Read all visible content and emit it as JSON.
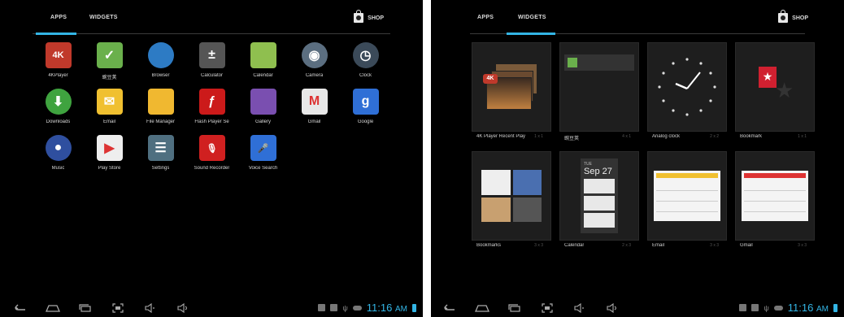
{
  "left": {
    "tabs": {
      "apps": "APPS",
      "widgets": "WIDGETS"
    },
    "shop": "SHOP",
    "apps": [
      {
        "label": "4KPlayer",
        "icon": "4k-player-icon",
        "color": "#c0392b",
        "glyph": "4K"
      },
      {
        "label": "豌豆荚",
        "icon": "wandoujia-icon",
        "color": "#6ab04c",
        "glyph": "✓"
      },
      {
        "label": "Browser",
        "icon": "globe-icon",
        "color": "#2d7bc4",
        "glyph": ""
      },
      {
        "label": "Calculator",
        "icon": "calculator-icon",
        "color": "#555555",
        "glyph": "±"
      },
      {
        "label": "Calendar",
        "icon": "calendar-icon",
        "color": "#8fbf4f",
        "glyph": ""
      },
      {
        "label": "Camera",
        "icon": "camera-icon",
        "color": "#5b6e80",
        "glyph": "◉"
      },
      {
        "label": "Clock",
        "icon": "clock-icon",
        "color": "#3b4a59",
        "glyph": "◷"
      },
      {
        "label": "Downloads",
        "icon": "download-icon",
        "color": "#3fa33f",
        "glyph": "⬇"
      },
      {
        "label": "Email",
        "icon": "email-icon",
        "color": "#f0c030",
        "glyph": "✉"
      },
      {
        "label": "File Manager",
        "icon": "folder-icon",
        "color": "#f0b830",
        "glyph": ""
      },
      {
        "label": "Flash Player Se",
        "icon": "flash-icon",
        "color": "#cc1a1a",
        "glyph": "ƒ"
      },
      {
        "label": "Gallery",
        "icon": "gallery-icon",
        "color": "#7a4fb0",
        "glyph": ""
      },
      {
        "label": "Gmail",
        "icon": "gmail-icon",
        "color": "#e8e8e8",
        "glyph": "M"
      },
      {
        "label": "Google",
        "icon": "google-icon",
        "color": "#2f6fd6",
        "glyph": "g"
      },
      {
        "label": "Music",
        "icon": "music-icon",
        "color": "#2f4f9f",
        "glyph": "●"
      },
      {
        "label": "Play Store",
        "icon": "play-store-icon",
        "color": "#eeeeee",
        "glyph": "▶"
      },
      {
        "label": "Settings",
        "icon": "settings-icon",
        "color": "#4f6f80",
        "glyph": "☰"
      },
      {
        "label": "Sound Recorder",
        "icon": "microphone-red-icon",
        "color": "#d02020",
        "glyph": "🎙"
      },
      {
        "label": "Voice Search",
        "icon": "microphone-blue-icon",
        "color": "#2f6fd6",
        "glyph": "🎤"
      }
    ],
    "clock": {
      "time": "11:16",
      "ampm": "AM"
    }
  },
  "right": {
    "tabs": {
      "apps": "APPS",
      "widgets": "WIDGETS"
    },
    "shop": "SHOP",
    "widgets": [
      {
        "name": "4K Player Recent Play",
        "size": "1 x 1"
      },
      {
        "name": "豌豆荚",
        "size": "4 x 1"
      },
      {
        "name": "Analog clock",
        "size": "2 x 2"
      },
      {
        "name": "Bookmark",
        "size": "1 x 1"
      },
      {
        "name": "Bookmarks",
        "size": "3 x 3"
      },
      {
        "name": "Calendar",
        "size": "2 x 3"
      },
      {
        "name": "Email",
        "size": "3 x 3"
      },
      {
        "name": "Gmail",
        "size": "3 x 3"
      }
    ],
    "calendar_preview": {
      "day": "TUE",
      "date": "Sep 27"
    },
    "clock": {
      "time": "11:16",
      "ampm": "AM"
    }
  },
  "colors": {
    "accent": "#33b5e5",
    "background": "#000000"
  }
}
